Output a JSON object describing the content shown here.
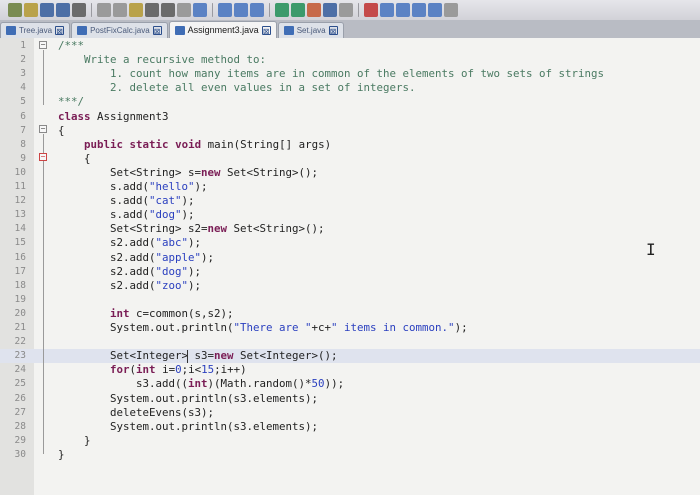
{
  "tabs": [
    {
      "label": "Tree.java",
      "active": false
    },
    {
      "label": "PostFixCalc.java",
      "active": false
    },
    {
      "label": "Assignment3.java",
      "active": true
    },
    {
      "label": "Set.java",
      "active": false
    }
  ],
  "tab_close_glyph": "⊠",
  "editor": {
    "lines": [
      {
        "n": "1",
        "text": "/***"
      },
      {
        "n": "2",
        "text": "    Write a recursive method to:"
      },
      {
        "n": "3",
        "text": "        1. count how many items are in common of the elements of two sets of strings"
      },
      {
        "n": "4",
        "text": "        2. delete all even values in a set of integers."
      },
      {
        "n": "5",
        "text": "***/"
      },
      {
        "n": "6",
        "text": "class Assignment3"
      },
      {
        "n": "7",
        "text": "{"
      },
      {
        "n": "8",
        "text": "    public static void main(String[] args)"
      },
      {
        "n": "9",
        "text": "    {"
      },
      {
        "n": "10",
        "text": "        Set<String> s=new Set<String>();"
      },
      {
        "n": "11",
        "text": "        s.add(\"hello\");"
      },
      {
        "n": "12",
        "text": "        s.add(\"cat\");"
      },
      {
        "n": "13",
        "text": "        s.add(\"dog\");"
      },
      {
        "n": "14",
        "text": "        Set<String> s2=new Set<String>();"
      },
      {
        "n": "15",
        "text": "        s2.add(\"abc\");"
      },
      {
        "n": "16",
        "text": "        s2.add(\"apple\");"
      },
      {
        "n": "17",
        "text": "        s2.add(\"dog\");"
      },
      {
        "n": "18",
        "text": "        s2.add(\"zoo\");"
      },
      {
        "n": "19",
        "text": ""
      },
      {
        "n": "20",
        "text": "        int c=common(s,s2);"
      },
      {
        "n": "21",
        "text": "        System.out.println(\"There are \"+c+\" items in common.\");"
      },
      {
        "n": "22",
        "text": ""
      },
      {
        "n": "23",
        "text": "        Set<Integer> s3=new Set<Integer>();"
      },
      {
        "n": "24",
        "text": "        for(int i=0;i<15;i++)"
      },
      {
        "n": "25",
        "text": "            s3.add((int)(Math.random()*50));"
      },
      {
        "n": "26",
        "text": "        System.out.println(s3.elements);"
      },
      {
        "n": "27",
        "text": "        deleteEvens(s3);"
      },
      {
        "n": "28",
        "text": "        System.out.println(s3.elements);"
      },
      {
        "n": "29",
        "text": "    }"
      },
      {
        "n": "30",
        "text": "}"
      }
    ],
    "current_line": "23"
  }
}
